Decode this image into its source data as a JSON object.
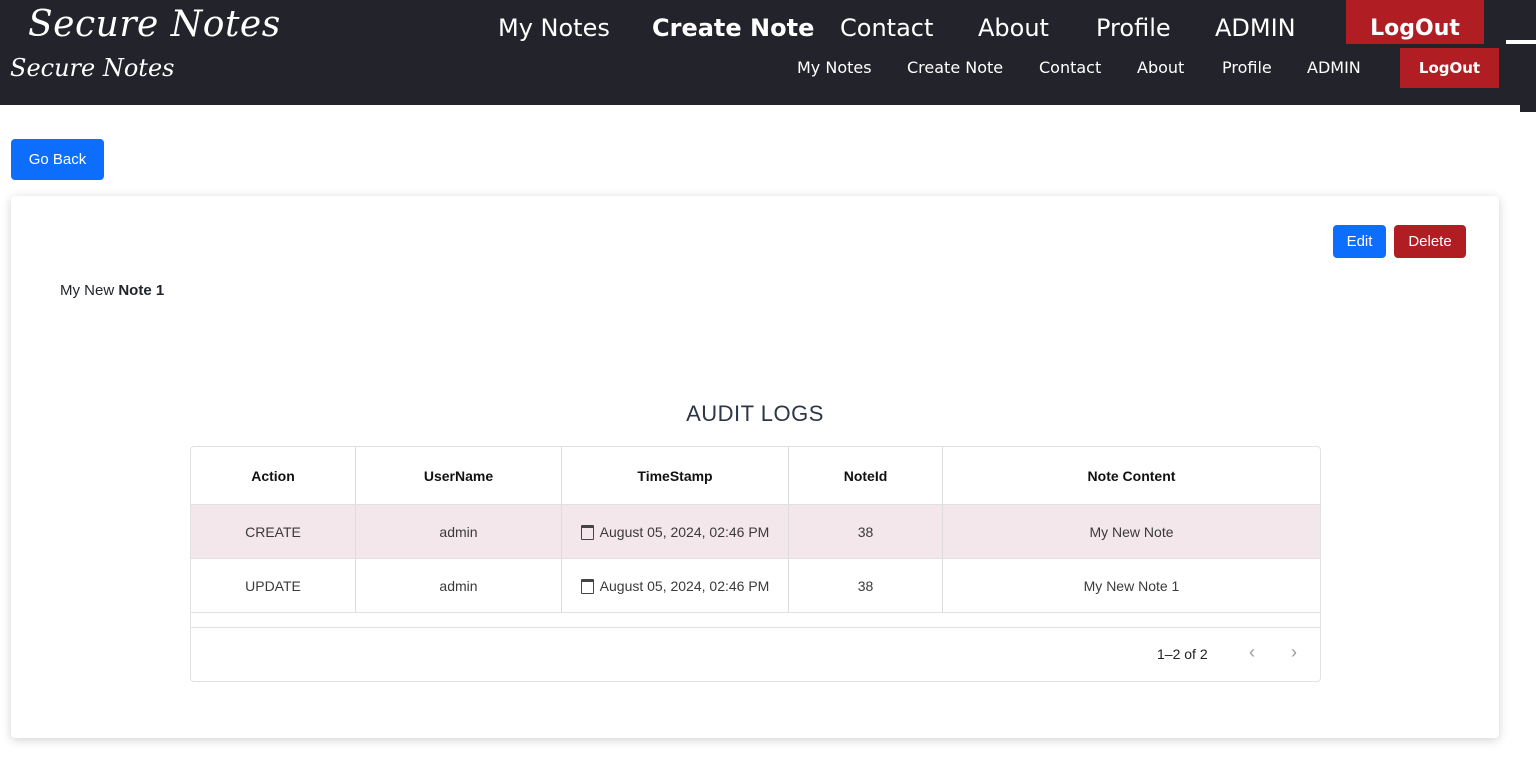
{
  "nav_large": {
    "brand": "Secure Notes",
    "links": [
      "My Notes",
      "Create Note",
      "Contact",
      "About",
      "Profile",
      "ADMIN"
    ],
    "active": "Create Note",
    "logout": "LogOut"
  },
  "nav_small": {
    "brand": "Secure Notes",
    "links": [
      "My Notes",
      "Create Note",
      "Contact",
      "About",
      "Profile",
      "ADMIN"
    ],
    "logout": "LogOut"
  },
  "go_back": "Go Back",
  "note": {
    "edit": "Edit",
    "delete": "Delete",
    "content_plain": "My New ",
    "content_bold": "Note 1"
  },
  "audit": {
    "title": "AUDIT LOGS",
    "columns": [
      "Action",
      "UserName",
      "TimeStamp",
      "NoteId",
      "Note Content"
    ],
    "rows": [
      {
        "action": "CREATE",
        "user": "admin",
        "time": "August 05, 2024, 02:46 PM",
        "noteId": "38",
        "content": "My New Note"
      },
      {
        "action": "UPDATE",
        "user": "admin",
        "time": "August 05, 2024, 02:46 PM",
        "noteId": "38",
        "content": "My New Note 1"
      }
    ],
    "pagination": "1–2 of 2",
    "prev_icon": "chevron-left-icon",
    "next_icon": "chevron-right-icon"
  },
  "colors": {
    "nav_bg": "#23232b",
    "primary": "#0d6efd",
    "danger": "#b01e24",
    "row_highlight": "#f3e7eb"
  }
}
